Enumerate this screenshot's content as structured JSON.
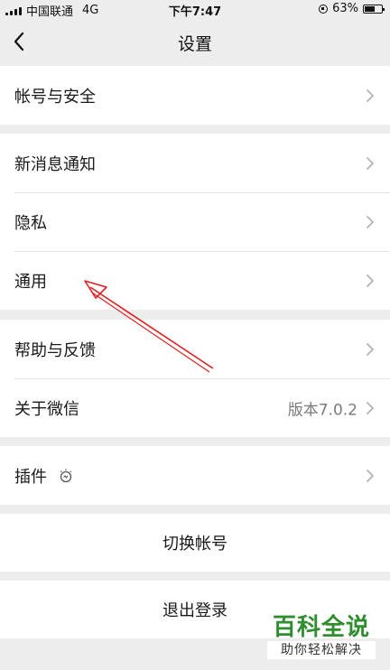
{
  "status_bar": {
    "carrier": "中国联通",
    "network": "4G",
    "time": "下午7:47",
    "battery_text": "63%",
    "battery_level": 0.63
  },
  "nav": {
    "title": "设置",
    "back_icon": "chevron-left-icon"
  },
  "groups": [
    {
      "items": [
        {
          "label": "帐号与安全"
        }
      ]
    },
    {
      "items": [
        {
          "label": "新消息通知"
        },
        {
          "label": "隐私"
        },
        {
          "label": "通用"
        }
      ]
    },
    {
      "items": [
        {
          "label": "帮助与反馈"
        },
        {
          "label": "关于微信",
          "value": "版本7.0.2"
        }
      ]
    },
    {
      "items": [
        {
          "label": "插件",
          "icon": "plugin-bulb-icon"
        }
      ]
    }
  ],
  "actions": {
    "switch_account": "切换帐号",
    "logout": "退出登录"
  },
  "watermark": {
    "title": "百科全说",
    "subtitle": "助你轻松解决"
  },
  "colors": {
    "background": "#ededed",
    "annotation_arrow": "#e02020",
    "watermark_green": "#2f8f2f"
  }
}
